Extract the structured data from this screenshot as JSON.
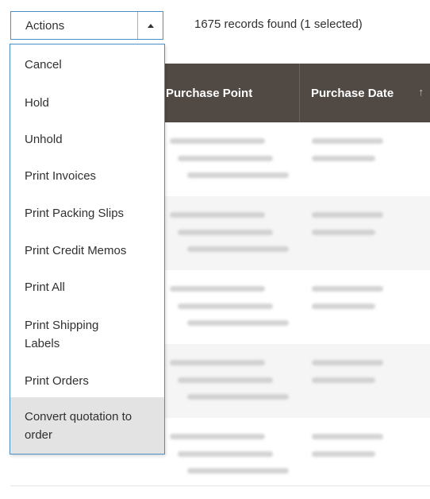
{
  "toolbar": {
    "actions_label": "Actions",
    "records_text": "1675 records found (1 selected)"
  },
  "grid": {
    "columns": [
      "Purchase Point",
      "Purchase Date"
    ],
    "sort_indicator": "↑"
  },
  "actions_menu": {
    "items": [
      {
        "label": "Cancel"
      },
      {
        "label": "Hold"
      },
      {
        "label": "Unhold"
      },
      {
        "label": "Print Invoices"
      },
      {
        "label": "Print Packing Slips"
      },
      {
        "label": "Print Credit Memos"
      },
      {
        "label": "Print All"
      },
      {
        "label": "Print Shipping Labels"
      },
      {
        "label": "Print Orders"
      },
      {
        "label": "Convert quotation to order",
        "highlighted": true
      }
    ]
  },
  "colors": {
    "header_bg": "#514943",
    "focus_border": "#4a90c8",
    "highlight_bg": "#e3e3e3"
  }
}
